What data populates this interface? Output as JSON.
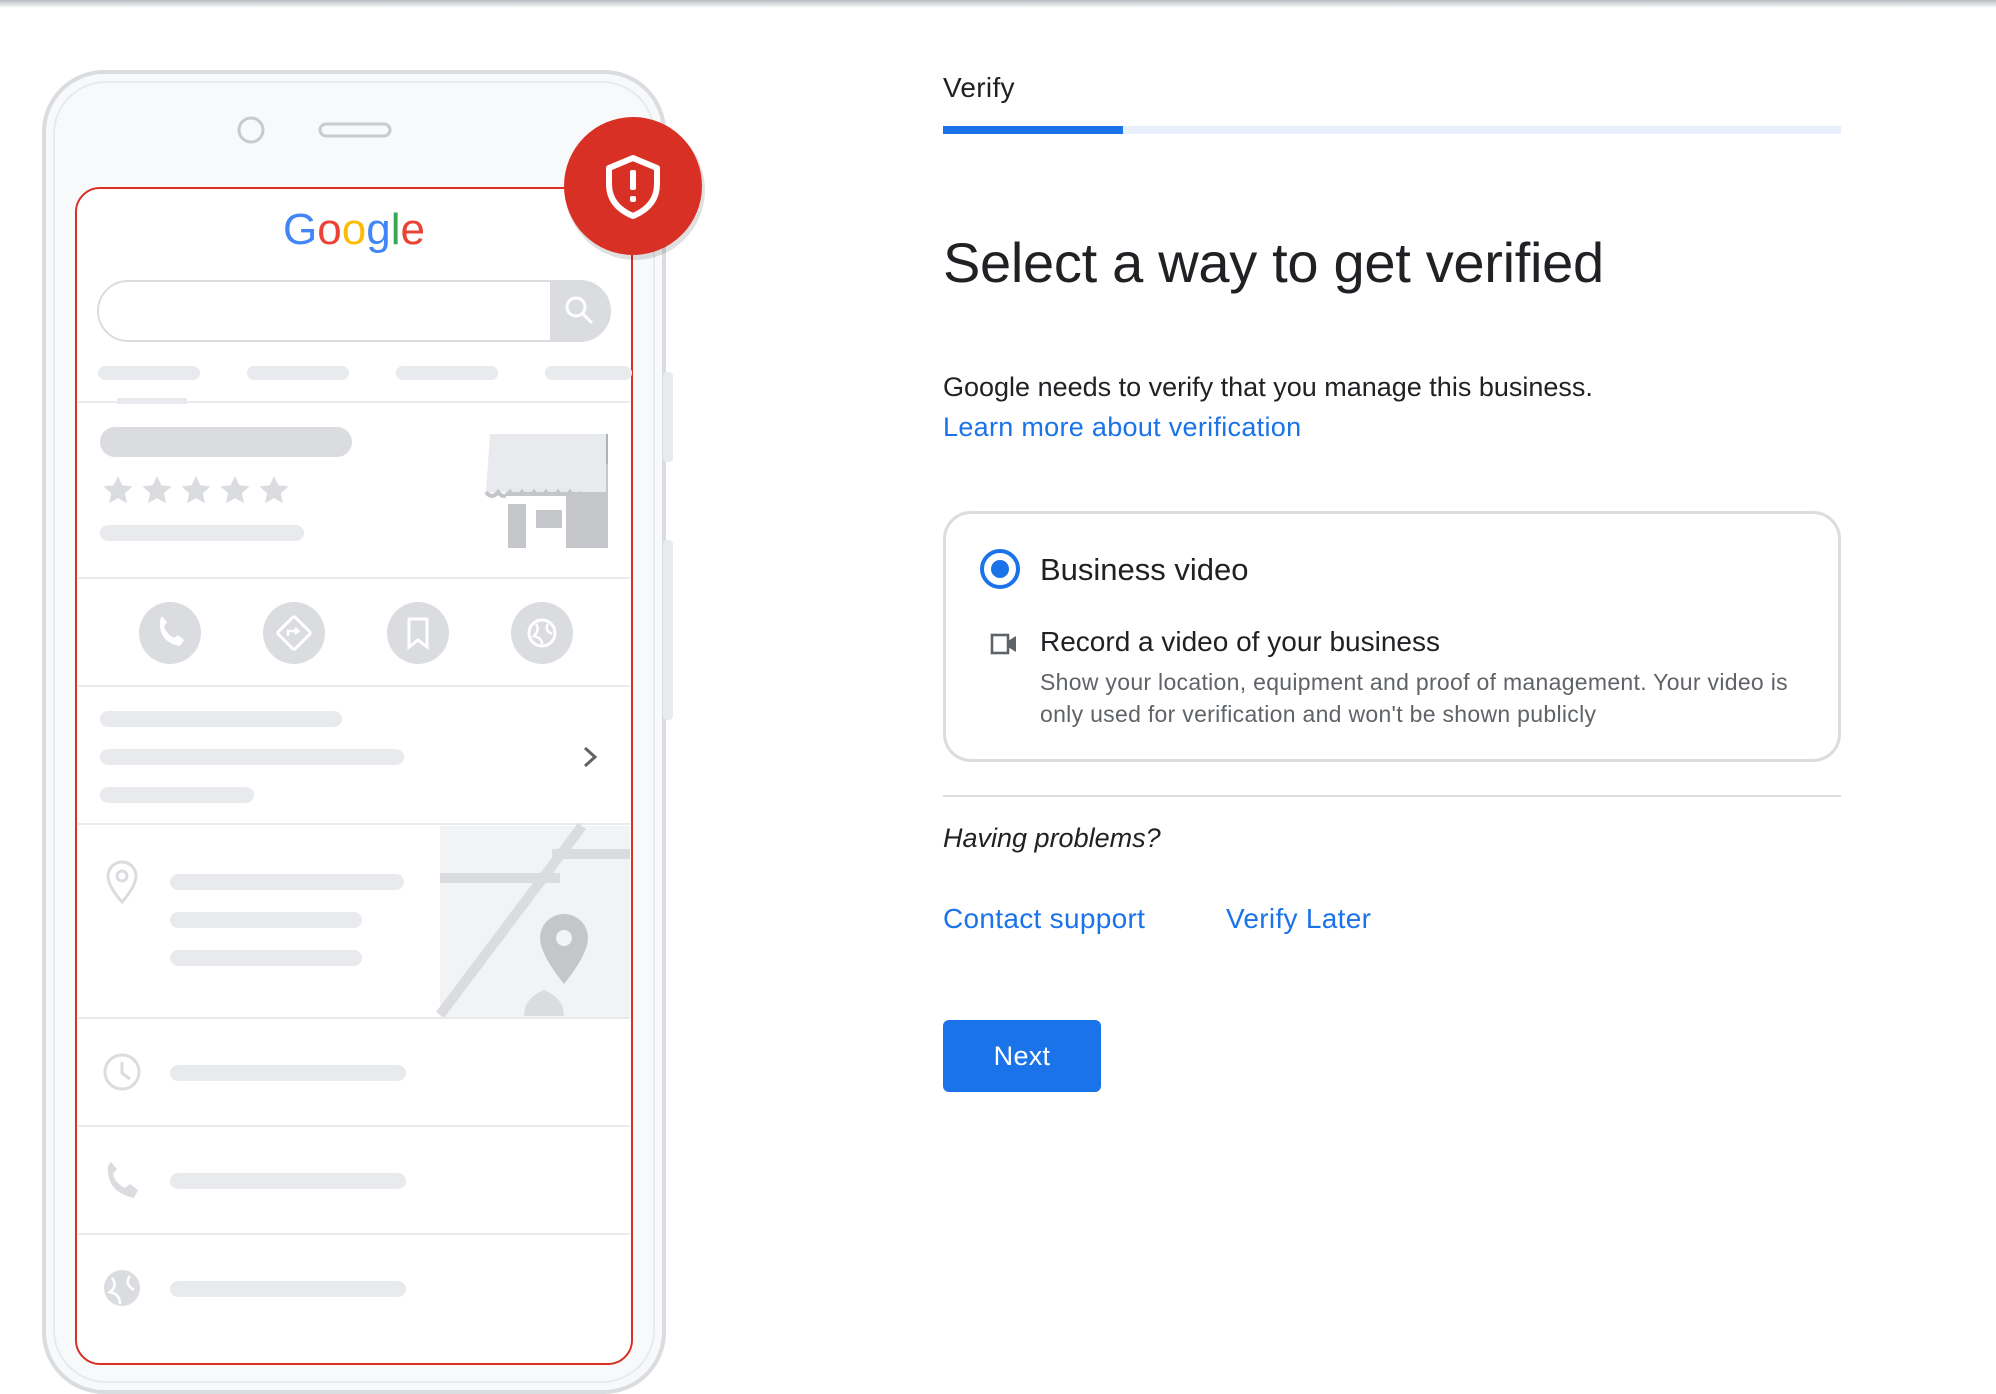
{
  "illustration": {
    "logo_text": "Google",
    "logo_colors": [
      "#4285F4",
      "#EA4335",
      "#FBBC05",
      "#4285F4",
      "#34A853",
      "#EA4335"
    ],
    "badge_color": "#D93025",
    "frame_color": "#D93025",
    "rating_stars": 5
  },
  "stepper": {
    "label": "Verify",
    "progress": 0.2
  },
  "title": "Select a way to get verified",
  "intro": {
    "text": "Google needs to verify that you manage this business.",
    "link": "Learn more about verification"
  },
  "option": {
    "title": "Business video",
    "selected": true,
    "icon": "videocam-icon",
    "subtitle": "Record a video of your business",
    "description": "Show your location, equipment and proof of management. Your video is only used for verification and won't be shown publicly"
  },
  "help": {
    "heading": "Having problems?",
    "contact": "Contact support",
    "later": "Verify Later"
  },
  "actions": {
    "next": "Next"
  },
  "colors": {
    "accent": "#1a73e8",
    "track": "#e8f0fe",
    "border": "#dadce0",
    "placeholder": "#dadce0"
  }
}
